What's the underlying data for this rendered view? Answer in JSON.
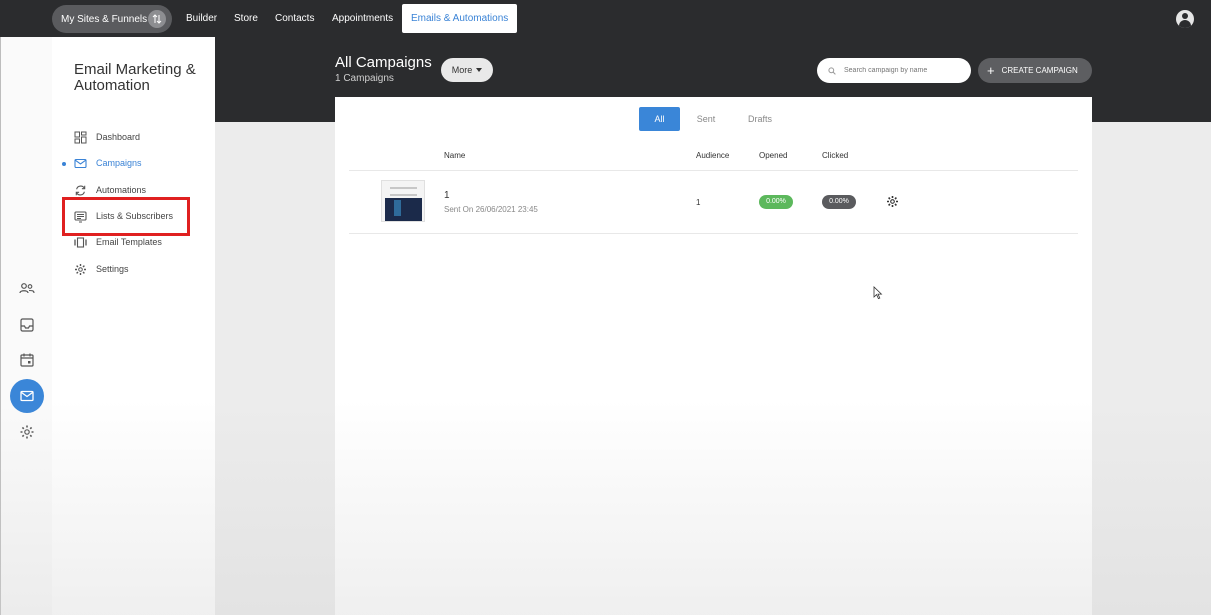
{
  "topnav": {
    "site_switcher": "My Sites & Funnels",
    "links": [
      "Builder",
      "Store",
      "Contacts",
      "Appointments"
    ],
    "active_link": "Emails & Automations"
  },
  "sidebar": {
    "title": "Email Marketing & Automation",
    "items": [
      {
        "label": "Dashboard",
        "icon": "dashboard-icon"
      },
      {
        "label": "Campaigns",
        "icon": "envelope-icon"
      },
      {
        "label": "Automations",
        "icon": "refresh-icon"
      },
      {
        "label": "Lists & Subscribers",
        "icon": "list-icon"
      },
      {
        "label": "Email Templates",
        "icon": "template-icon"
      },
      {
        "label": "Settings",
        "icon": "gear-icon"
      }
    ],
    "active_item": "Campaigns"
  },
  "rail": {
    "icons": [
      "contacts-icon",
      "inbox-icon",
      "calendar-icon",
      "email-icon",
      "settings-icon"
    ],
    "active_icon": "email-icon"
  },
  "header": {
    "title": "All Campaigns",
    "subtitle": "1 Campaigns",
    "more_label": "More",
    "search_placeholder": "Search campaign by name",
    "create_label": "CREATE CAMPAIGN"
  },
  "tabs": [
    "All",
    "Sent",
    "Drafts"
  ],
  "active_tab": "All",
  "table": {
    "columns": [
      "Name",
      "Audience",
      "Opened",
      "Clicked"
    ],
    "rows": [
      {
        "name": "1",
        "sent": "Sent On 26/06/2021 23:45",
        "audience": "1",
        "opened": "0.00%",
        "clicked": "0.00%"
      }
    ]
  },
  "colors": {
    "accent": "#3a86d8",
    "opened_badge": "#5cb85c",
    "clicked_badge": "#5a5b5e",
    "highlight": "#e02020"
  }
}
